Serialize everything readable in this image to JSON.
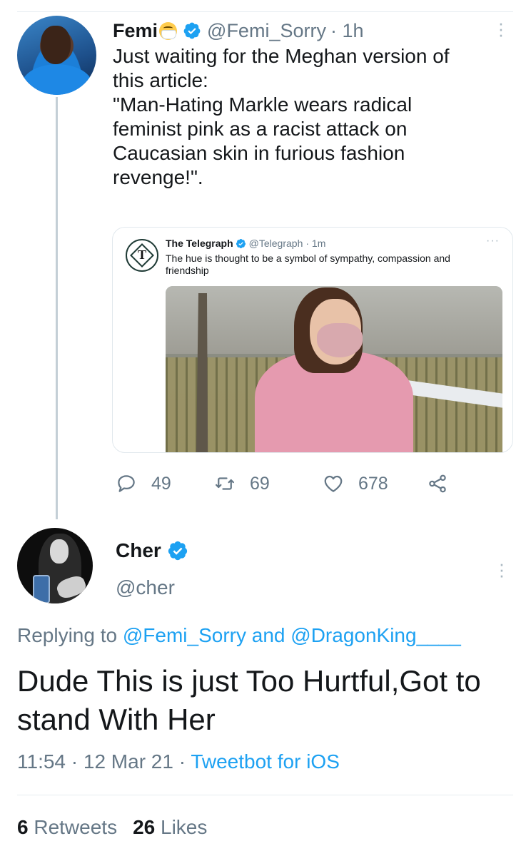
{
  "femi_tweet": {
    "name": "Femi",
    "name_emoji": "face-with-medical-mask-emoji",
    "handle": "@Femi_Sorry",
    "time": "· 1h",
    "text": "Just waiting for the Meghan version of\nthis article:\n\"Man-Hating Markle wears radical\nfeminist pink as a racist attack on\nCaucasian skin in furious fashion\nrevenge!\".",
    "replies": "49",
    "retweets": "69",
    "likes": "678"
  },
  "quoted_tweet": {
    "name": "The Telegraph",
    "handle": "@Telegraph",
    "time": "· 1m",
    "text": "The hue is thought to be a symbol of sympathy, compassion and friendship",
    "more": "···"
  },
  "cher_tweet": {
    "name": "Cher",
    "handle": "@cher",
    "replying_prefix": "Replying to",
    "mention1": "@Femi_Sorry",
    "and_word": "and",
    "mention2": "@DragonKing____",
    "text": "Dude This is just Too Hurtful,Got to stand With Her",
    "time": "11:54 · 12 Mar 21 ·",
    "source": "Tweetbot for iOS",
    "retweet_count": "6",
    "retweet_label": "Retweets",
    "like_count": "26",
    "like_label": "Likes"
  },
  "colors": {
    "accent": "#1da1f2",
    "secondary_text": "#657786",
    "primary_text": "#14171a",
    "divider": "#e6ecf0"
  },
  "icons": [
    "verified-badge-icon",
    "more-options-icon",
    "reply-icon",
    "retweet-icon",
    "like-icon",
    "share-icon"
  ]
}
